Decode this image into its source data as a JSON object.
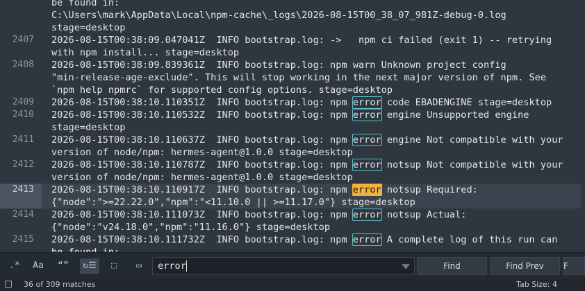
{
  "colors": {
    "editor_bg": "#2e363f",
    "match_outline": "#5ec2cf",
    "current_match": "#f2b13b",
    "findbar_bg": "#242a31"
  },
  "lines": [
    {
      "num": "",
      "parts": [
        {
          "text": "be found in:"
        }
      ]
    },
    {
      "num": "",
      "parts": [
        {
          "text": "C:\\Users\\mark\\AppData\\Local\\npm-cache\\_logs\\2026-08-15T00_38_07_981Z-debug-0.log"
        }
      ]
    },
    {
      "num": "",
      "parts": [
        {
          "text": "stage=desktop"
        }
      ]
    },
    {
      "num": "2407",
      "parts": [
        {
          "text": "2026-08-15T00:38:09.047041Z  INFO bootstrap.log: ->   npm ci failed (exit 1) -- retrying"
        }
      ]
    },
    {
      "num": "",
      "parts": [
        {
          "text": "with npm install... stage=desktop"
        }
      ]
    },
    {
      "num": "2408",
      "parts": [
        {
          "text": "2026-08-15T00:38:09.839361Z  INFO bootstrap.log: npm warn Unknown project config"
        }
      ]
    },
    {
      "num": "",
      "parts": [
        {
          "text": "\"min-release-age-exclude\". This will stop working in the next major version of npm. See"
        }
      ]
    },
    {
      "num": "",
      "parts": [
        {
          "text": "`npm help npmrc` for supported config options. stage=desktop"
        }
      ]
    },
    {
      "num": "2409",
      "parts": [
        {
          "text": "2026-08-15T00:38:10.110351Z  INFO bootstrap.log: npm "
        },
        {
          "text": "error",
          "match": true
        },
        {
          "text": " code EBADENGINE stage=desktop"
        }
      ]
    },
    {
      "num": "2410",
      "parts": [
        {
          "text": "2026-08-15T00:38:10.110532Z  INFO bootstrap.log: npm "
        },
        {
          "text": "error",
          "match": true
        },
        {
          "text": " engine Unsupported engine"
        }
      ]
    },
    {
      "num": "",
      "parts": [
        {
          "text": "stage=desktop"
        }
      ]
    },
    {
      "num": "2411",
      "parts": [
        {
          "text": "2026-08-15T00:38:10.110637Z  INFO bootstrap.log: npm "
        },
        {
          "text": "error",
          "match": true
        },
        {
          "text": " engine Not compatible with your"
        }
      ]
    },
    {
      "num": "",
      "parts": [
        {
          "text": "version of node/npm: hermes-agent@1.0.0 stage=desktop"
        }
      ]
    },
    {
      "num": "2412",
      "parts": [
        {
          "text": "2026-08-15T00:38:10.110787Z  INFO bootstrap.log: npm "
        },
        {
          "text": "error",
          "match": true
        },
        {
          "text": " notsup Not compatible with your"
        }
      ]
    },
    {
      "num": "",
      "parts": [
        {
          "text": "version of node/npm: hermes-agent@1.0.0 stage=desktop"
        }
      ]
    },
    {
      "num": "2413",
      "current": true,
      "parts": [
        {
          "text": "2026-08-15T00:38:10.110917Z  INFO bootstrap.log: npm "
        },
        {
          "text": "error",
          "match": true,
          "current": true
        },
        {
          "text": " notsup Required:"
        }
      ]
    },
    {
      "num": "",
      "current": true,
      "parts": [
        {
          "text": "{\"node\":\">=22.22.0\",\"npm\":\"<11.10.0 || >=11.17.0\"} stage=desktop"
        }
      ]
    },
    {
      "num": "2414",
      "parts": [
        {
          "text": "2026-08-15T00:38:10.111073Z  INFO bootstrap.log: npm "
        },
        {
          "text": "error",
          "match": true
        },
        {
          "text": " notsup Actual:"
        }
      ]
    },
    {
      "num": "",
      "parts": [
        {
          "text": "{\"node\":\"v24.18.0\",\"npm\":\"11.16.0\"} stage=desktop"
        }
      ]
    },
    {
      "num": "2415",
      "parts": [
        {
          "text": "2026-08-15T00:38:10.111732Z  INFO bootstrap.log: npm "
        },
        {
          "text": "error",
          "match": true
        },
        {
          "text": " A complete log of this run can"
        }
      ]
    },
    {
      "num": "",
      "parts": [
        {
          "text": "be found in:"
        }
      ]
    }
  ],
  "findbar": {
    "regex_label": ".*",
    "case_label": "Aa",
    "whole_word_label": "“”",
    "wrap_label": "↻☰",
    "in_selection_label": "⬚",
    "highlight_label": "▭",
    "query": "error",
    "find_label": "Find",
    "find_prev_label": "Find Prev",
    "find_all_label": "F"
  },
  "status": {
    "matches": "36 of 309 matches",
    "tab_size": "Tab Size: 4"
  }
}
